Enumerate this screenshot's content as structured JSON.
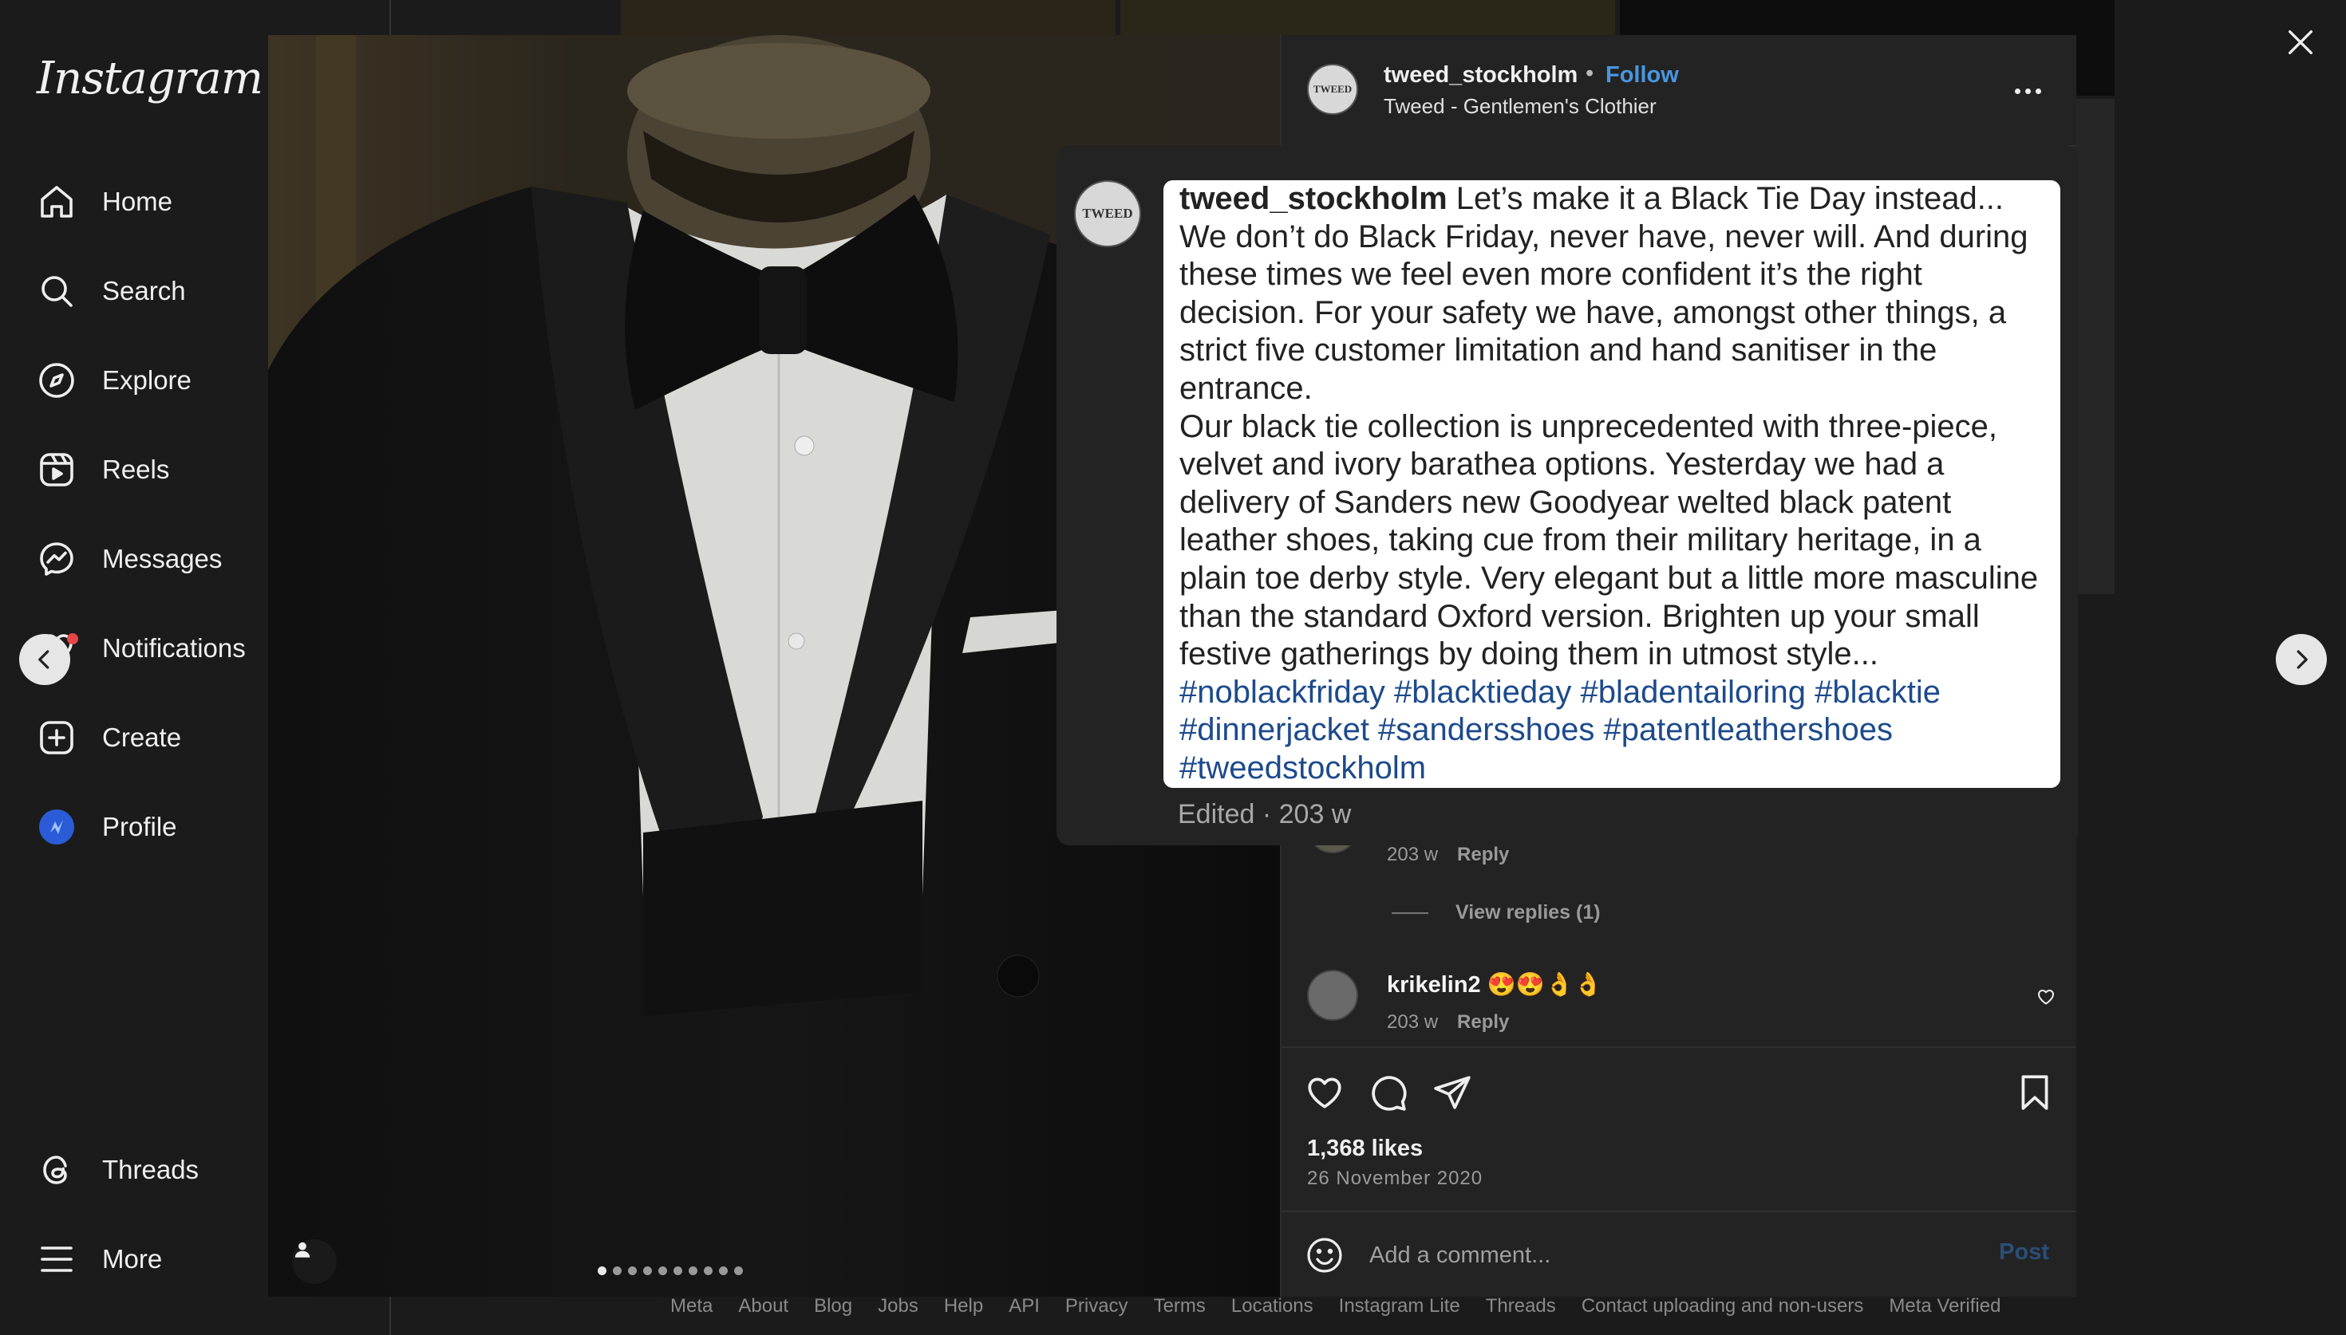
{
  "brand": "Instagram",
  "sidebar": {
    "items": [
      {
        "label": "Home",
        "icon": "home-icon"
      },
      {
        "label": "Search",
        "icon": "search-icon"
      },
      {
        "label": "Explore",
        "icon": "explore-compass-icon"
      },
      {
        "label": "Reels",
        "icon": "reels-icon"
      },
      {
        "label": "Messages",
        "icon": "messenger-icon"
      },
      {
        "label": "Notifications",
        "icon": "heart-icon"
      },
      {
        "label": "Create",
        "icon": "plus-square-icon"
      },
      {
        "label": "Profile",
        "icon": "profile-avatar-icon"
      }
    ],
    "bottom": [
      {
        "label": "Threads",
        "icon": "threads-icon"
      },
      {
        "label": "More",
        "icon": "hamburger-menu-icon"
      }
    ]
  },
  "post": {
    "username": "tweed_stockholm",
    "separator": "•",
    "follow_label": "Follow",
    "subtitle": "Tweed - Gentlemen's Clothier",
    "avatar_text": "TWEED",
    "carousel": {
      "count": 10,
      "active_index": 0
    }
  },
  "caption": {
    "username": "tweed_stockholm",
    "paragraph1": "Let’s make it a Black Tie Day instead... We don’t do Black Friday, never have, never will. And during these times we feel even more confident it’s the right decision. For your safety we have, amongst other things, a strict five customer limitation and hand sanitiser in the entrance.",
    "paragraph2": "Our black tie collection is unprecedented with three-piece, velvet and ivory barathea options. Yesterday we had a delivery of Sanders new Goodyear welted black patent leather shoes, taking cue from their military heritage, in a plain toe derby style. Very elegant but a little more masculine than the standard Oxford version. Brighten up your small festive gatherings by doing them in utmost style...",
    "hashtags": "#noblackfriday #blacktieday #bladentailoring #blacktie #dinnerjacket #sandersshoes #patentleathershoes #tweedstockholm",
    "meta": "Edited · 203 w"
  },
  "comments": [
    {
      "time": "203 w",
      "reply_label": "Reply",
      "view_replies": "View replies (1)"
    },
    {
      "username": "krikelin2",
      "text": "😍😍👌👌",
      "time": "203 w",
      "reply_label": "Reply"
    }
  ],
  "stats": {
    "likes": "1,368 likes",
    "date": "26 November 2020"
  },
  "comment_box": {
    "placeholder": "Add a comment...",
    "post_label": "Post"
  },
  "footer": [
    "Meta",
    "About",
    "Blog",
    "Jobs",
    "Help",
    "API",
    "Privacy",
    "Terms",
    "Locations",
    "Instagram Lite",
    "Threads",
    "Contact uploading and non-users",
    "Meta Verified"
  ],
  "colors": {
    "link": "#4a96e0",
    "hashtag": "#1d4a8c",
    "notification_dot": "#e8454a"
  }
}
